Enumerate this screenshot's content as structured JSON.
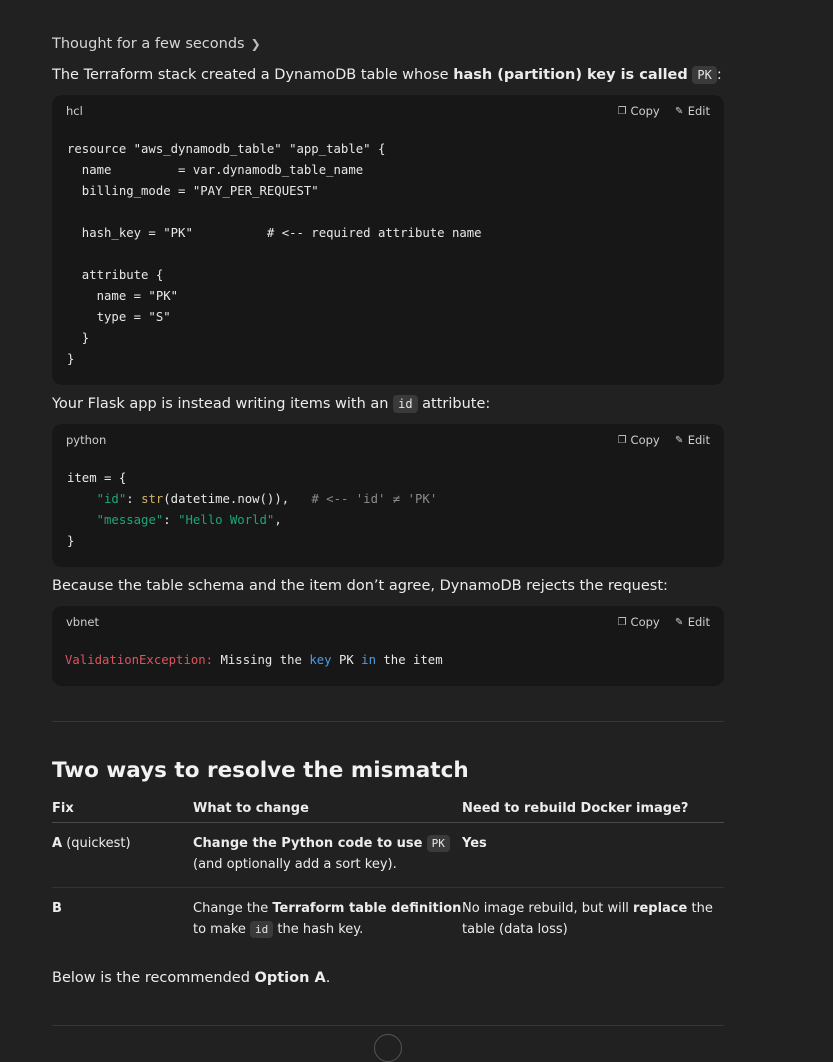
{
  "thought_label": "Thought for a few seconds",
  "intro": {
    "pre": "The Terraform stack created a DynamoDB table whose ",
    "bold": "hash (partition) key is called",
    "code": "PK",
    "post": ":"
  },
  "code_actions": {
    "copy": "Copy",
    "edit": "Edit"
  },
  "code_blocks": [
    {
      "lang": "hcl"
    },
    {
      "lang": "python"
    },
    {
      "lang": "vbnet"
    }
  ],
  "hcl_lines": [
    "resource \"aws_dynamodb_table\" \"app_table\" {",
    "  name         = var.dynamodb_table_name",
    "  billing_mode = \"PAY_PER_REQUEST\"",
    "",
    "  hash_key = \"PK\"          # <-- required attribute name",
    "",
    "  attribute {",
    "    name = \"PK\"",
    "    type = \"S\"",
    "  }",
    "}"
  ],
  "python_code": {
    "l1": "item = {",
    "k1": "\"id\"",
    "fn": "str",
    "call": "(datetime.now()),",
    "comment": "# <-- 'id' ≠ 'PK'",
    "k2": "\"message\"",
    "v2": "\"Hello World\"",
    "close": "}"
  },
  "vbnet_code": {
    "err": "ValidationException:",
    "t1": " Missing the ",
    "kw1": "key",
    "t2": " PK ",
    "kw2": "in",
    "t3": " the item"
  },
  "flask_para": {
    "pre": "Your Flask app is instead writing items with an ",
    "code": "id",
    "post": " attribute:"
  },
  "because_para": "Because the table schema and the item don’t agree, DynamoDB rejects the request:",
  "section_heading": "Two ways to resolve the mismatch",
  "table": {
    "headers": [
      "Fix",
      "What to change",
      "Need to rebuild Docker image?"
    ],
    "row_a": {
      "fix_bold": "A",
      "fix_rest": " (quickest)",
      "what_bold": "Change the Python code to use",
      "what_code": "PK",
      "what_rest": "(and optionally add a sort key).",
      "rebuild": "Yes"
    },
    "row_b": {
      "fix_bold": "B",
      "what_pre": "Change the ",
      "what_bold": "Terraform table definition",
      "what_mid": "to make ",
      "what_code": "id",
      "what_post": " the hash key.",
      "rebuild_pre": "No image rebuild, but will ",
      "rebuild_bold": "replace",
      "rebuild_post": " the table (data loss)"
    }
  },
  "closing": {
    "pre": "Below is the recommended ",
    "bold": "Option A",
    "post": "."
  }
}
